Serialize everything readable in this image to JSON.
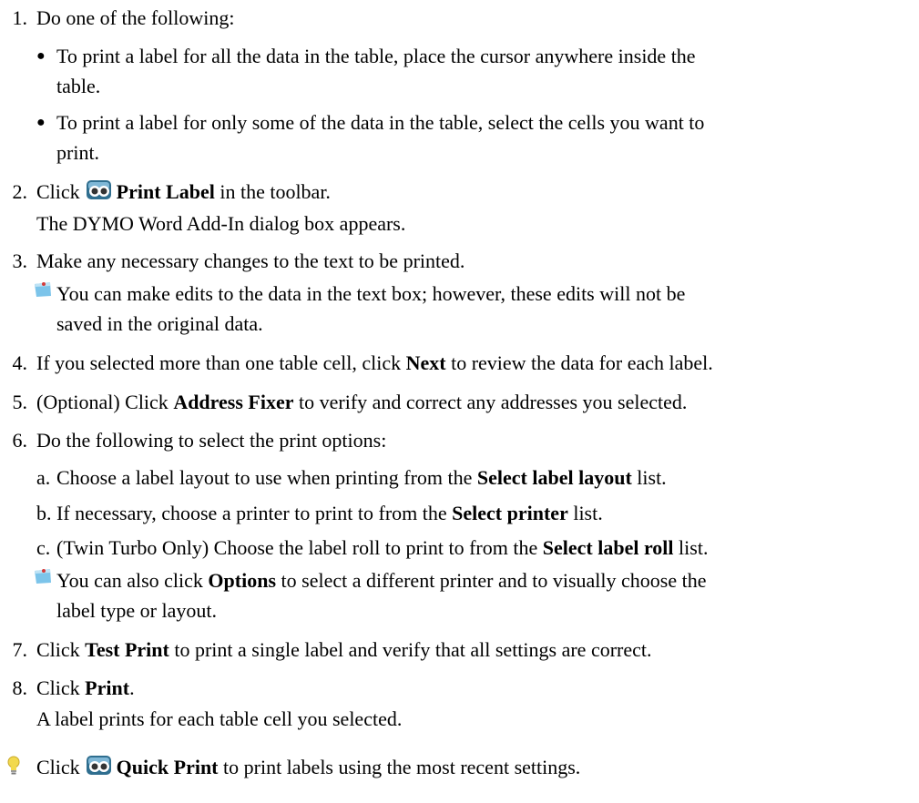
{
  "steps": {
    "s1": {
      "num": "1.",
      "text": "Do one of the following:",
      "b1": "To print a label for all the data in the table, place the cursor anywhere inside the",
      "b1_cont": "table.",
      "b2": "To print a label for only some of the data in the table, select the cells you want to",
      "b2_cont": "print."
    },
    "s2": {
      "num": "2.",
      "pre": "Click",
      "bold": "Print Label",
      "post": "in the toolbar.",
      "result": "The DYMO Word Add-In dialog box appears."
    },
    "s3": {
      "num": "3.",
      "text": "Make any necessary changes to the text to be printed.",
      "note": "You can make edits to the data in the text box; however, these edits will not be",
      "note_cont": "saved in the original data."
    },
    "s4": {
      "num": "4.",
      "pre": "If you selected more than one table cell, click",
      "bold": "Next",
      "post": "to review the data for each label."
    },
    "s5": {
      "num": "5.",
      "pre": "(Optional) Click",
      "bold": "Address Fixer",
      "post": "to verify and correct any addresses you selected."
    },
    "s6": {
      "num": "6.",
      "text": "Do the following to select the print options:",
      "a": {
        "letter": "a.",
        "pre": "Choose a label layout to use when printing from the",
        "bold": "Select label layout",
        "post": "list."
      },
      "b": {
        "letter": "b.",
        "pre": "If necessary, choose a printer to print to from the",
        "bold": "Select printer",
        "post": "list."
      },
      "c": {
        "letter": "c.",
        "pre": "(Twin Turbo Only) Choose the label roll to print to from the",
        "bold": "Select label roll",
        "post": "list."
      },
      "note_pre": "You can also click",
      "note_bold": "Options",
      "note_post": "to select a different printer and to visually choose the",
      "note_cont": "label type or layout."
    },
    "s7": {
      "num": "7.",
      "pre": "Click",
      "bold": "Test Print",
      "post": "to print a single label and verify that all settings are correct."
    },
    "s8": {
      "num": "8.",
      "pre": "Click",
      "bold": "Print",
      "post": ".",
      "result": "A label prints for each table cell you selected."
    }
  },
  "tip": {
    "pre": "Click",
    "bold": "Quick Print",
    "post": "to print labels using the most recent settings."
  },
  "icons": {
    "toolbar_icon": "dymo-print-label-icon",
    "note_icon": "note-icon",
    "tip_icon": "lightbulb-tip-icon",
    "note_color": "#7cc4ea",
    "tip_color": "#f2d94e"
  }
}
